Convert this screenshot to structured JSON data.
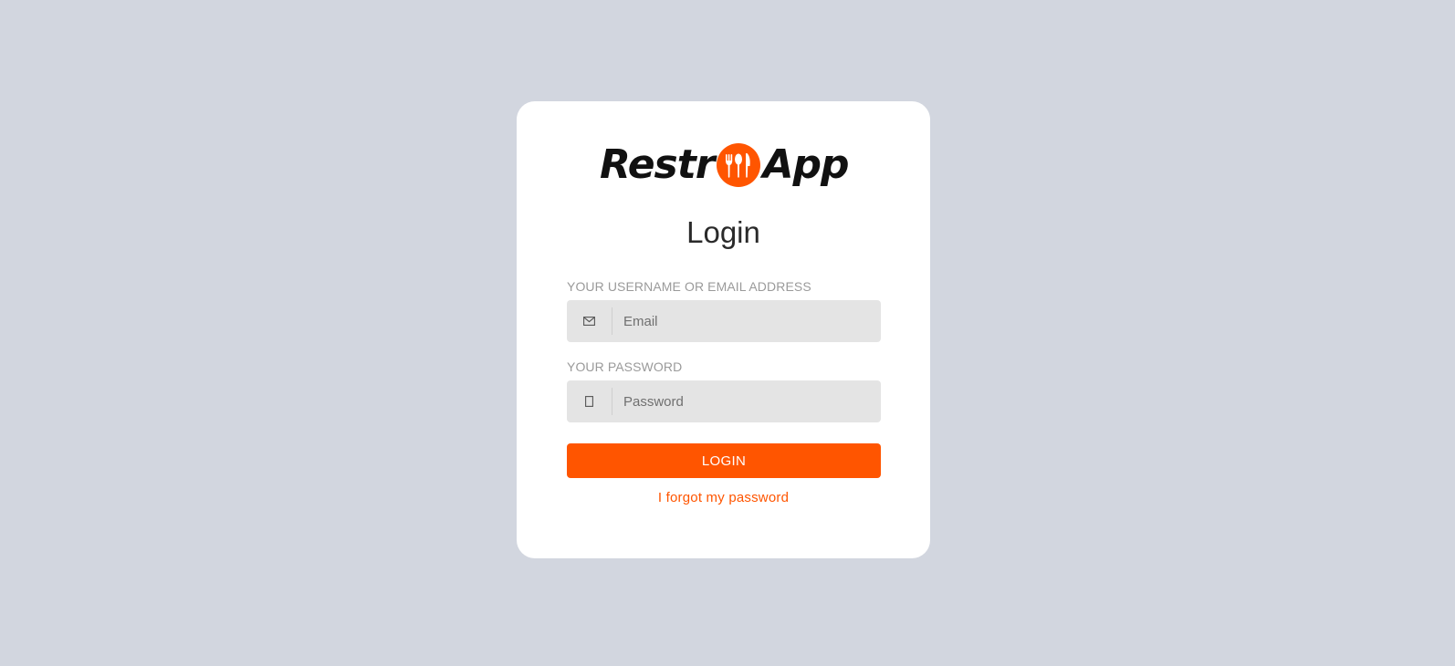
{
  "brand": {
    "part1": "Restr",
    "part2": "App",
    "accent_color": "#ff5500"
  },
  "login": {
    "title": "Login",
    "username_label": "YOUR USERNAME OR EMAIL ADDRESS",
    "email_placeholder": "Email",
    "email_icon": "envelope-icon",
    "password_label": "YOUR PASSWORD",
    "password_placeholder": "Password",
    "password_icon": "lock-icon",
    "submit_label": "LOGIN",
    "forgot_link": "I forgot my password"
  },
  "colors": {
    "background": "#d2d6df",
    "card": "#ffffff",
    "input_bg": "#e4e4e4",
    "label": "#9a9a9a"
  }
}
